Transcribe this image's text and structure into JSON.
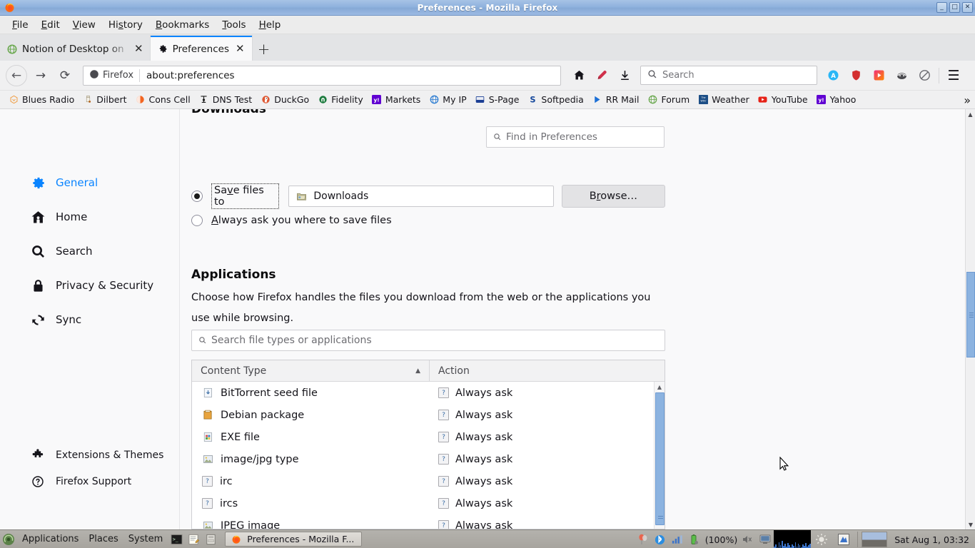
{
  "window": {
    "title": "Preferences - Mozilla Firefox",
    "minimize": "_",
    "maximize": "□",
    "close": "✕"
  },
  "menubar": [
    {
      "label": "File",
      "accel": "F"
    },
    {
      "label": "Edit",
      "accel": "E"
    },
    {
      "label": "View",
      "accel": "V"
    },
    {
      "label": "History",
      "accel": "s"
    },
    {
      "label": "Bookmarks",
      "accel": "B"
    },
    {
      "label": "Tools",
      "accel": "T"
    },
    {
      "label": "Help",
      "accel": "H"
    }
  ],
  "tabs": [
    {
      "label": "Notion of Desktop on Ub",
      "icon": "globe-icon",
      "active": false
    },
    {
      "label": "Preferences",
      "icon": "gear-icon",
      "active": true
    }
  ],
  "newtab_label": "+",
  "tab_close_label": "✕",
  "navbar": {
    "back": "←",
    "forward": "→",
    "reload": "⟳",
    "identity_label": "Firefox",
    "url": "about:preferences",
    "home": "home-icon",
    "library": "bookmark-icon",
    "downloads": "download-icon",
    "search_placeholder": "Search",
    "menu": "☰",
    "extensions": [
      "adblock-icon",
      "shield-icon",
      "video-downloader-icon",
      "privacy-badger-icon",
      "noscript-icon"
    ]
  },
  "bookmarks": [
    {
      "label": "Blues Radio",
      "icon": "hexagon-icon",
      "color": "#f0a04a"
    },
    {
      "label": "Dilbert",
      "icon": "person-icon",
      "color": "#b5651d"
    },
    {
      "label": "Cons Cell",
      "icon": "circle-icon",
      "color": "#f26522"
    },
    {
      "label": "DNS Test",
      "icon": "anchor-icon",
      "color": "#1a1a1a"
    },
    {
      "label": "DuckGo",
      "icon": "duck-icon",
      "color": "#de5833"
    },
    {
      "label": "Fidelity",
      "icon": "arch-icon",
      "color": "#1b7a3d"
    },
    {
      "label": "Markets",
      "icon": "yahoo-icon",
      "color": "#6001d2"
    },
    {
      "label": "My IP",
      "icon": "globe-icon",
      "color": "#2d7dd2"
    },
    {
      "label": "S-Page",
      "icon": "window-icon",
      "color": "#1c3f94"
    },
    {
      "label": "Softpedia",
      "icon": "s-icon",
      "color": "#16489c"
    },
    {
      "label": "RR Mail",
      "icon": "play-icon",
      "color": "#1b6fd6"
    },
    {
      "label": "Forum",
      "icon": "globe-icon",
      "color": "#6aa84f"
    },
    {
      "label": "Weather",
      "icon": "weather-icon",
      "color": "#1c4e86"
    },
    {
      "label": "YouTube",
      "icon": "youtube-icon",
      "color": "#e62117"
    },
    {
      "label": "Yahoo",
      "icon": "yahoo-icon",
      "color": "#6001d2"
    }
  ],
  "bookmarks_overflow": "»",
  "preferences": {
    "find_placeholder": "Find in Preferences",
    "sidebar": [
      {
        "label": "General",
        "icon": "gear-icon",
        "active": true
      },
      {
        "label": "Home",
        "icon": "home-icon",
        "active": false
      },
      {
        "label": "Search",
        "icon": "search-icon",
        "active": false
      },
      {
        "label": "Privacy & Security",
        "icon": "lock-icon",
        "active": false
      },
      {
        "label": "Sync",
        "icon": "sync-icon",
        "active": false
      }
    ],
    "sidebar_bottom": [
      {
        "label": "Extensions & Themes",
        "icon": "puzzle-icon"
      },
      {
        "label": "Firefox Support",
        "icon": "question-circle-icon"
      }
    ],
    "downloads": {
      "heading": "Downloads",
      "save_files_to_label": "Save files to",
      "save_files_to_selected": true,
      "folder_icon": "folder-icon",
      "folder_value": "Downloads",
      "browse_label": "Browse…",
      "always_ask_label": "Always ask you where to save files",
      "always_ask_selected": false
    },
    "applications": {
      "heading": "Applications",
      "description": "Choose how Firefox handles the files you download from the web or the applications you use while browsing.",
      "search_placeholder": "Search file types or applications",
      "columns": [
        "Content Type",
        "Action"
      ],
      "sort_indicator": "▲",
      "rows": [
        {
          "type": "BitTorrent seed file",
          "type_icon": "torrent-file-icon",
          "action": "Always ask",
          "action_icon": "question-icon"
        },
        {
          "type": "Debian package",
          "type_icon": "deb-package-icon",
          "action": "Always ask",
          "action_icon": "question-icon"
        },
        {
          "type": "EXE file",
          "type_icon": "exe-file-icon",
          "action": "Always ask",
          "action_icon": "question-icon"
        },
        {
          "type": "image/jpg type",
          "type_icon": "image-file-icon",
          "action": "Always ask",
          "action_icon": "question-icon"
        },
        {
          "type": "irc",
          "type_icon": "question-icon",
          "action": "Always ask",
          "action_icon": "question-icon"
        },
        {
          "type": "ircs",
          "type_icon": "question-icon",
          "action": "Always ask",
          "action_icon": "question-icon"
        },
        {
          "type": "JPEG image",
          "type_icon": "image-file-icon",
          "action": "Always ask",
          "action_icon": "question-icon"
        }
      ]
    }
  },
  "taskbar": {
    "menus": [
      "Applications",
      "Places",
      "System"
    ],
    "launchers": [
      "terminal-icon",
      "text-editor-icon",
      "files-icon"
    ],
    "window_button": {
      "label": "Preferences - Mozilla F...",
      "icon": "firefox-icon"
    },
    "tray": {
      "battery_percent": "(100%)",
      "clock": "Sat Aug 1, 03:32",
      "icons": [
        "balloon-icon",
        "bluetooth-icon",
        "network-icon",
        "battery-icon",
        "volume-muted-icon",
        "display-icon",
        "brightness-icon",
        "workspace-icon"
      ]
    }
  },
  "colors": {
    "accent": "#0a84ff",
    "titlebar": "#8fb2dd",
    "content_bg": "#f9f9fa",
    "scrollbar_thumb": "#8cb3e0"
  }
}
